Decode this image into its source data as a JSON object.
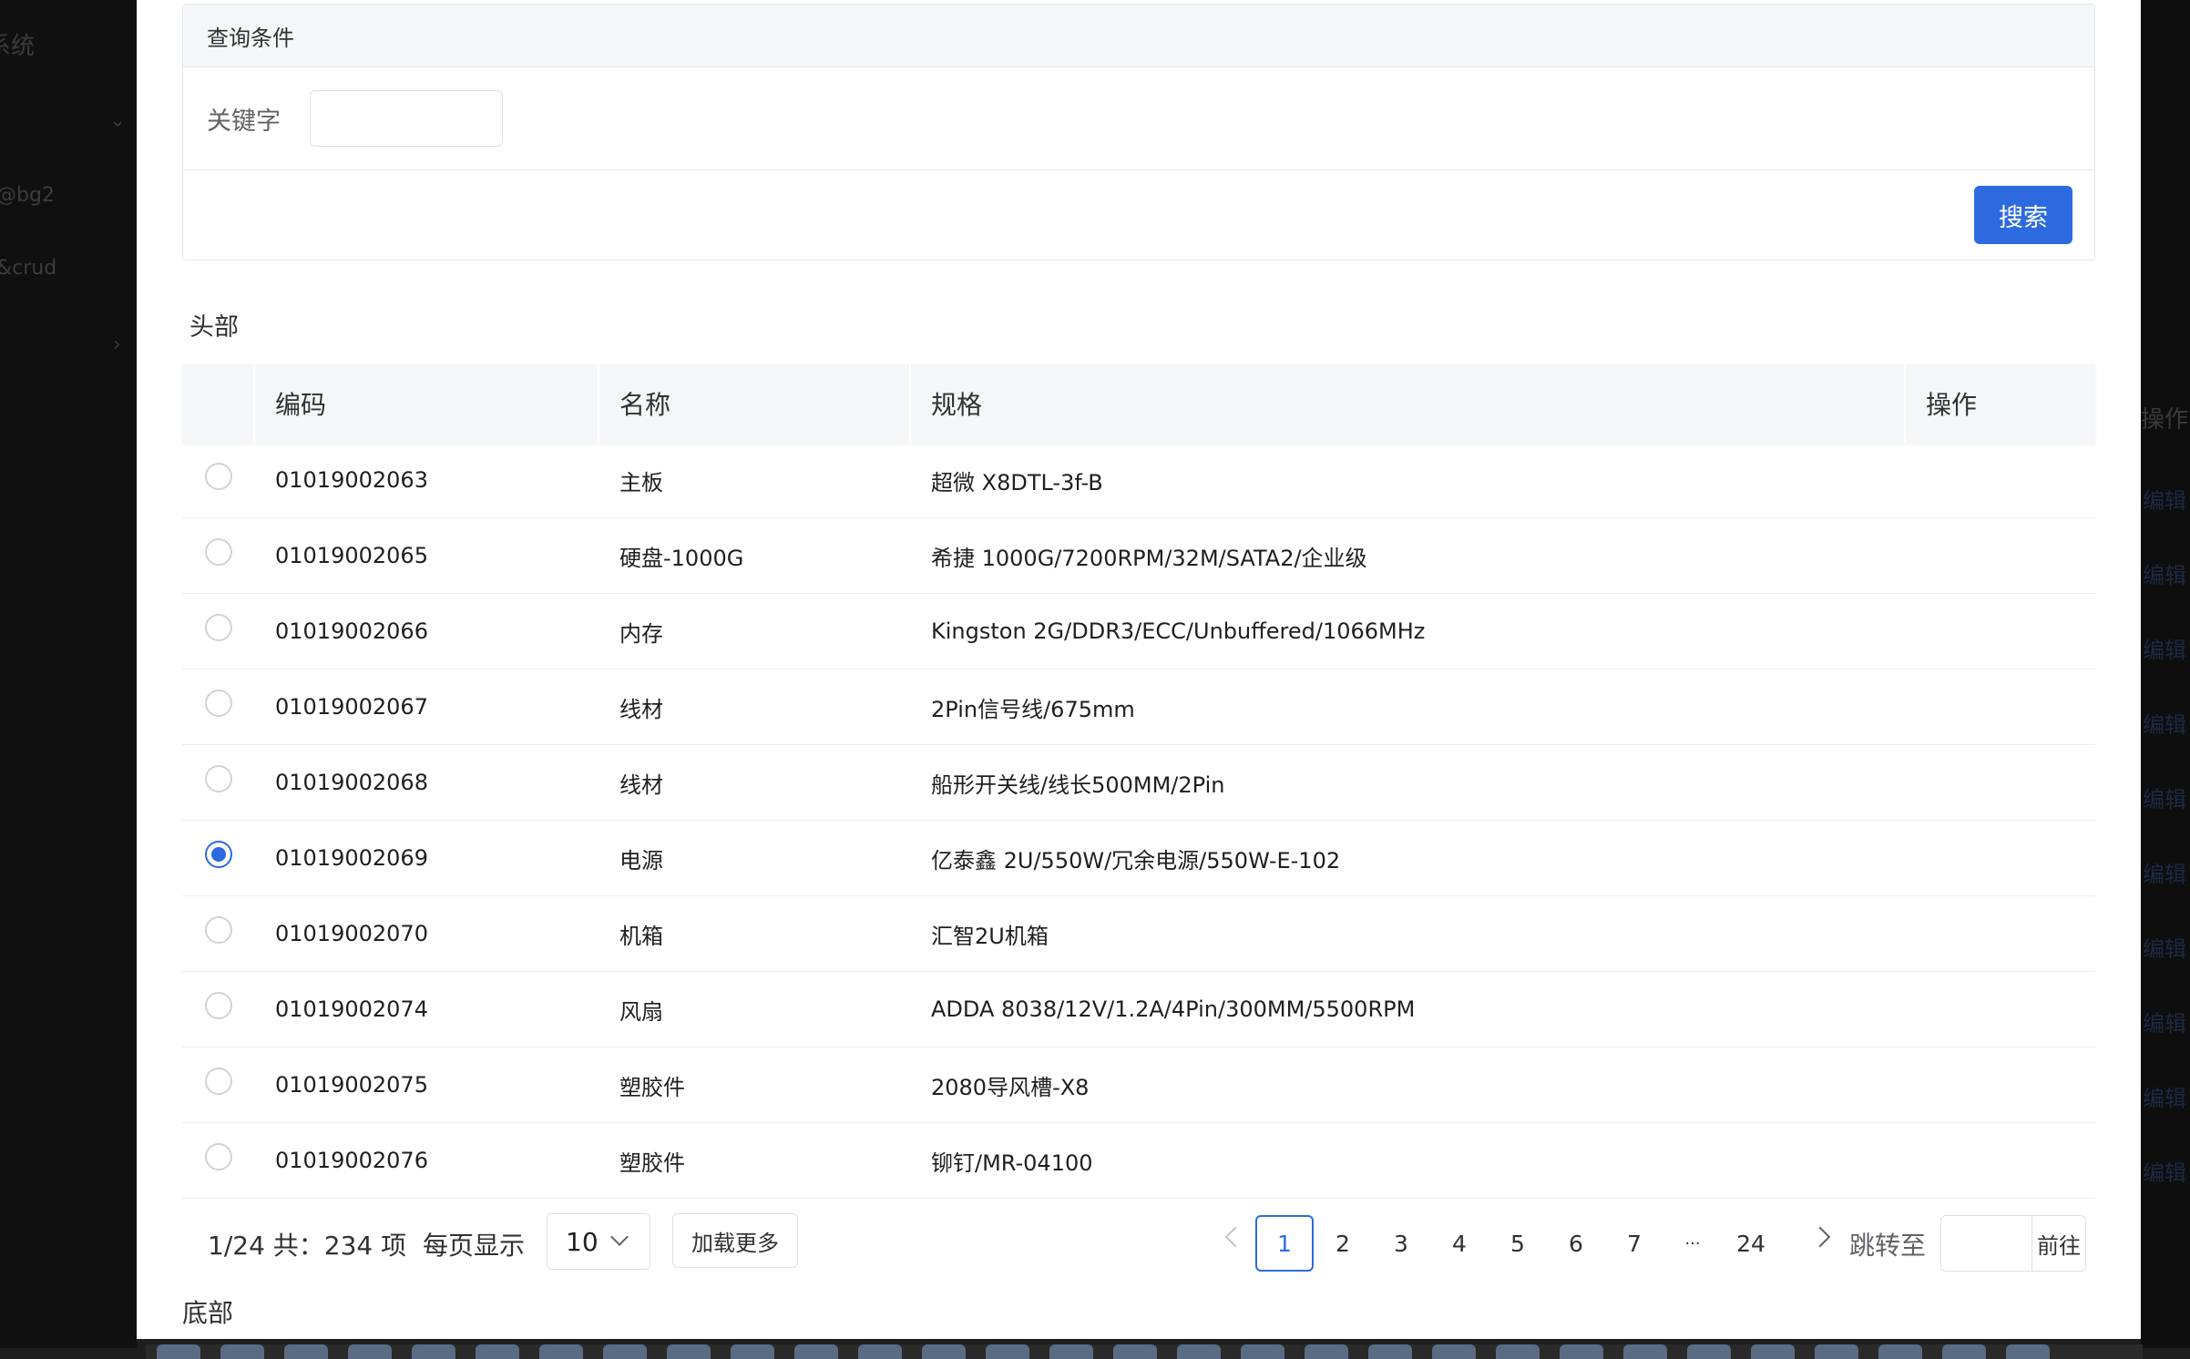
{
  "background": {
    "sidebar": {
      "system_fragment": "系统",
      "item_bg2": "@bg2",
      "item_crud": "&crud"
    },
    "right_table": {
      "header": "操作",
      "edit_links": [
        "编辑",
        "编辑",
        "编辑",
        "编辑",
        "编辑",
        "编辑",
        "编辑",
        "编辑",
        "编辑",
        "编辑"
      ]
    }
  },
  "query": {
    "title": "查询条件",
    "keyword_label": "关键字",
    "keyword_value": "",
    "search_button": "搜索"
  },
  "section_header": "头部",
  "table": {
    "columns": [
      "编码",
      "名称",
      "规格",
      "操作"
    ],
    "selected_index": 5,
    "rows": [
      {
        "code": "01019002063",
        "name": "主板",
        "spec": "超微 X8DTL-3f-B"
      },
      {
        "code": "01019002065",
        "name": "硬盘-1000G",
        "spec": "希捷 1000G/7200RPM/32M/SATA2/企业级"
      },
      {
        "code": "01019002066",
        "name": "内存",
        "spec": "Kingston 2G/DDR3/ECC/Unbuffered/1066MHz"
      },
      {
        "code": "01019002067",
        "name": "线材",
        "spec": "2Pin信号线/675mm"
      },
      {
        "code": "01019002068",
        "name": "线材",
        "spec": "船形开关线/线长500MM/2Pin"
      },
      {
        "code": "01019002069",
        "name": "电源",
        "spec": "亿泰鑫 2U/550W/冗余电源/550W-E-102"
      },
      {
        "code": "01019002070",
        "name": "机箱",
        "spec": "汇智2U机箱"
      },
      {
        "code": "01019002074",
        "name": "风扇",
        "spec": "ADDA 8038/12V/1.2A/4Pin/300MM/5500RPM"
      },
      {
        "code": "01019002075",
        "name": "塑胶件",
        "spec": "2080导风槽-X8"
      },
      {
        "code": "01019002076",
        "name": "塑胶件",
        "spec": "铆钉/MR-04100"
      }
    ]
  },
  "pagination": {
    "info": "1/24 共：234 项",
    "page_size_label": "每页显示",
    "page_size": "10",
    "load_more": "加载更多",
    "pages": [
      "1",
      "2",
      "3",
      "4",
      "5",
      "6",
      "7",
      "···",
      "24"
    ],
    "current": "1",
    "jump_label": "跳转至",
    "go_button": "前往"
  },
  "footer": "底部",
  "colors": {
    "primary": "#2d6ae0",
    "header_bg": "#f5f6f8",
    "border": "#ebeef5"
  }
}
